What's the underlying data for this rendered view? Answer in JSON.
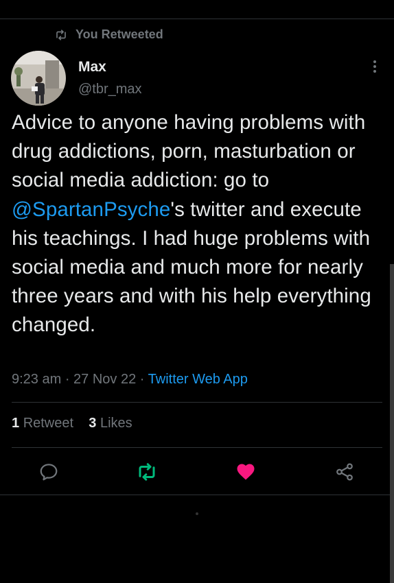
{
  "retweet_label": "You Retweeted",
  "author": {
    "name": "Max",
    "handle": "@tbr_max"
  },
  "tweet": {
    "text_before": "Advice to anyone having problems with drug addictions, porn, masturbation or social media addiction: go to ",
    "mention": "@SpartanPsyche",
    "text_after": "'s twitter and execute his teachings. I had huge problems with social media and much more for nearly three years and with his help everything changed."
  },
  "meta": {
    "time": "9:23 am",
    "sep1": " · ",
    "date": "27 Nov 22",
    "sep2": " · ",
    "source": "Twitter Web App"
  },
  "stats": {
    "retweets_count": "1",
    "retweets_label": "Retweet",
    "likes_count": "3",
    "likes_label": "Likes"
  },
  "colors": {
    "accent": "#1d9bf0",
    "retweet_active": "#00ba7c",
    "like_active": "#f91880",
    "muted": "#71767b"
  },
  "icons": [
    "retweet-icon",
    "more-icon",
    "reply-icon",
    "retweet-icon",
    "like-icon",
    "share-icon"
  ]
}
